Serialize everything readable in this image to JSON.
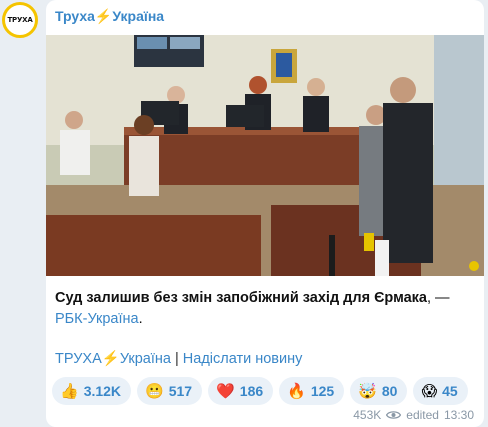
{
  "channel": {
    "name_prefix": "Труха",
    "bolt": "⚡",
    "name_suffix": "Україна",
    "avatar_text": "ТРУХА"
  },
  "post": {
    "lead": "Суд залишив без змін запобіжний захід для Єрмака",
    "separator": ", — ",
    "source_link": "РБК-Україна",
    "period": "."
  },
  "footer": {
    "channel_link_prefix": "ТРУХА",
    "channel_link_bolt": "⚡",
    "channel_link_suffix": "Україна",
    "divider": " | ",
    "submit_link": "Надіслати новину"
  },
  "reactions": [
    {
      "icon": "thumbs-up",
      "emoji": "👍",
      "count": "3.12K"
    },
    {
      "icon": "grimace",
      "emoji": "😬",
      "count": "517"
    },
    {
      "icon": "heart",
      "emoji": "❤️",
      "count": "186"
    },
    {
      "icon": "fire",
      "emoji": "🔥",
      "count": "125"
    },
    {
      "icon": "exploding-head",
      "emoji": "🤯",
      "count": "80"
    },
    {
      "icon": "scream",
      "emoji": "😱",
      "count": "45"
    }
  ],
  "meta": {
    "views": "453K",
    "edited_label": "edited",
    "time": "13:30"
  },
  "colors": {
    "accent": "#3a87c8",
    "bolt": "#f5a623",
    "reaction_bg": "#eaf1f8"
  }
}
